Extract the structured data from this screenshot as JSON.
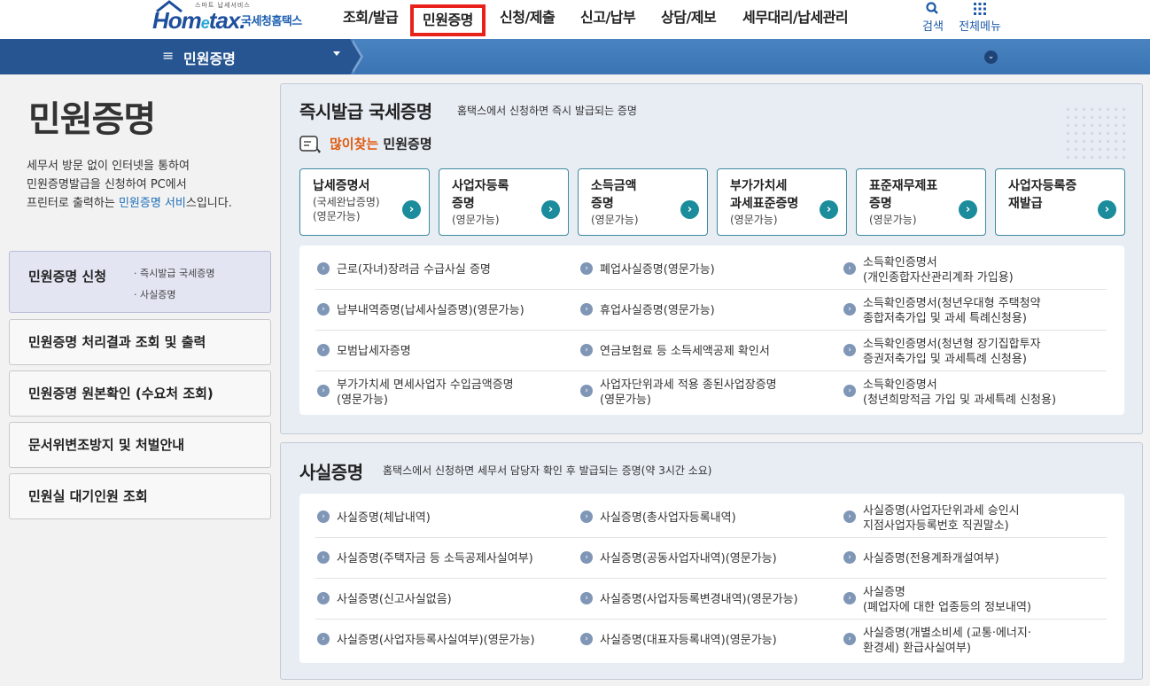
{
  "header": {
    "logo_small": "스마트 납세서비스",
    "logo_brand_pre": "Hom",
    "logo_brand_e": "e",
    "logo_brand_post": "tax.",
    "logo_kor": "국세청홈택스",
    "nav": [
      "조회/발급",
      "민원증명",
      "신청/제출",
      "신고/납부",
      "상담/제보",
      "세무대리/납세관리"
    ],
    "active_nav": "민원증명",
    "search_label": "검색",
    "allmenu_label": "전체메뉴"
  },
  "subbar": {
    "label": "민원증명"
  },
  "sidebar": {
    "title": "민원증명",
    "desc_1": "세무서 방문 없이 인터넷을 통하여",
    "desc_2": "민원증명발급을 신청하여 PC에서",
    "desc_3a": "프린터로 출력하는 ",
    "desc_3b": "민원증명 서비",
    "desc_3c": "스입니다.",
    "menus": [
      {
        "label": "민원증명 신청",
        "subs": [
          "· 즉시발급 국세증명",
          "· 사실증명"
        ]
      },
      {
        "label": "민원증명 처리결과 조회 및 출력"
      },
      {
        "label": "민원증명 원본확인 (수요처 조회)"
      },
      {
        "label": "문서위변조방지 및 처벌안내"
      },
      {
        "label": "민원실 대기인원 조회"
      }
    ]
  },
  "instant": {
    "title": "즉시발급 국세증명",
    "subtitle": "홈택스에서 신청하면 즉시 발급되는 증명",
    "popular_hl": "많이찾는",
    "popular_rest": " 민원증명",
    "cards": [
      {
        "l1": "납세증명서",
        "l2a": "(국세완납증명)",
        "l2b": "(영문가능)"
      },
      {
        "l1": "사업자등록",
        "l1b": "증명",
        "l2a": "(영문가능)"
      },
      {
        "l1": "소득금액",
        "l1b": "증명",
        "l2a": "(영문가능)"
      },
      {
        "l1": "부가가치세",
        "l1b": "과세표준증명",
        "l2a": "(영문가능)"
      },
      {
        "l1": "표준재무제표",
        "l1b": "증명",
        "l2a": "(영문가능)"
      },
      {
        "l1": "사업자등록증",
        "l1b": "재발급"
      }
    ],
    "items": [
      [
        "근로(자녀)장려금 수급사실 증명",
        "",
        "폐업사실증명(영문가능)",
        "",
        "소득확인증명서",
        "(개인종합자산관리계좌 가입용)"
      ],
      [
        "납부내역증명(납세사실증명)(영문가능)",
        "",
        "휴업사실증명(영문가능)",
        "",
        "소득확인증명서(청년우대형 주택청약",
        "종합저축가입 및 과세 특례신청용)"
      ],
      [
        "모범납세자증명",
        "",
        "연금보험료 등 소득세액공제 확인서",
        "",
        "소득확인증명서(청년형 장기집합투자",
        "증권저축가입 및 과세특례 신청용)"
      ],
      [
        "부가가치세 면세사업자 수입금액증명",
        "(영문가능)",
        "사업자단위과세 적용 종된사업장증명",
        "(영문가능)",
        "소득확인증명서",
        "(청년희망적금 가입 및 과세특례 신청용)"
      ]
    ]
  },
  "fact": {
    "title": "사실증명",
    "subtitle": "홈택스에서 신청하면 세무서 담당자 확인 후 발급되는 증명(약 3시간 소요)",
    "items": [
      [
        "사실증명(체납내역)",
        "",
        "사실증명(총사업자등록내역)",
        "",
        "사실증명(사업자단위과세 승인시",
        "지점사업자등록번호 직권말소)"
      ],
      [
        "사실증명(주택자금 등 소득공제사실여부)",
        "",
        "사실증명(공동사업자내역)(영문가능)",
        "",
        "사실증명(전용계좌개설여부)",
        ""
      ],
      [
        "사실증명(신고사실없음)",
        "",
        "사실증명(사업자등록변경내역)(영문가능)",
        "",
        "사실증명",
        "(폐업자에 대한 업종등의 정보내역)"
      ],
      [
        "사실증명(사업자등록사실여부)(영문가능)",
        "",
        "사실증명(대표자등록내역)(영문가능)",
        "",
        "사실증명(개별소비세 (교통·에너지·",
        "환경세) 환급사실여부)"
      ]
    ]
  }
}
